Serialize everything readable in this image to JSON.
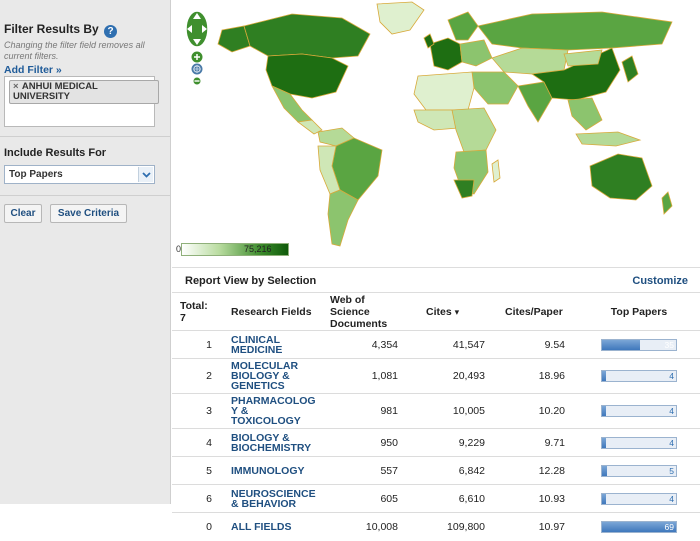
{
  "sidebar": {
    "filter_title": "Filter Results By",
    "help_icon": "?",
    "filter_note": "Changing the filter field removes all current filters.",
    "add_filter": "Add Filter »",
    "filter_chip": {
      "remove": "×",
      "label_line1": "ANHUI MEDICAL",
      "label_line2": "UNIVERSITY"
    },
    "include_title": "Include Results For",
    "include_select": "Top Papers",
    "clear_button": "Clear",
    "save_button": "Save Criteria"
  },
  "map": {
    "legend_min": "0",
    "legend_max": "75,216",
    "highlight_color": "#1e6e12",
    "base_color": "#cfe7b6",
    "border_color": "#d8a93a"
  },
  "report": {
    "title": "Report View by Selection",
    "customize": "Customize",
    "headers": {
      "total_label": "Total:",
      "total_value": "7",
      "field": "Research Fields",
      "docs_line1": "Web of Science",
      "docs_line2": "Documents",
      "cites": "Cites",
      "cites_sort_icon": "▾",
      "cites_per_paper": "Cites/Paper",
      "top_papers": "Top Papers"
    },
    "rows": [
      {
        "rank": "1",
        "field_l1": "CLINICAL",
        "field_l2": "MEDICINE",
        "field_l3": "",
        "docs": "4,354",
        "cites": "41,547",
        "cpp": "9.54",
        "top": "35",
        "top_frac": 0.51
      },
      {
        "rank": "2",
        "field_l1": "MOLECULAR",
        "field_l2": "BIOLOGY &",
        "field_l3": "GENETICS",
        "docs": "1,081",
        "cites": "20,493",
        "cpp": "18.96",
        "top": "4",
        "top_frac": 0.06
      },
      {
        "rank": "3",
        "field_l1": "PHARMACOLOG",
        "field_l2": "Y &",
        "field_l3": "TOXICOLOGY",
        "docs": "981",
        "cites": "10,005",
        "cpp": "10.20",
        "top": "4",
        "top_frac": 0.06
      },
      {
        "rank": "4",
        "field_l1": "BIOLOGY &",
        "field_l2": "BIOCHEMISTRY",
        "field_l3": "",
        "docs": "950",
        "cites": "9,229",
        "cpp": "9.71",
        "top": "4",
        "top_frac": 0.06
      },
      {
        "rank": "5",
        "field_l1": "IMMUNOLOGY",
        "field_l2": "",
        "field_l3": "",
        "docs": "557",
        "cites": "6,842",
        "cpp": "12.28",
        "top": "5",
        "top_frac": 0.07
      },
      {
        "rank": "6",
        "field_l1": "NEUROSCIENCE",
        "field_l2": "& BEHAVIOR",
        "field_l3": "",
        "docs": "605",
        "cites": "6,610",
        "cpp": "10.93",
        "top": "4",
        "top_frac": 0.06
      },
      {
        "rank": "0",
        "field_l1": "ALL FIELDS",
        "field_l2": "",
        "field_l3": "",
        "docs": "10,008",
        "cites": "109,800",
        "cpp": "10.97",
        "top": "69",
        "top_frac": 1.0
      }
    ]
  }
}
